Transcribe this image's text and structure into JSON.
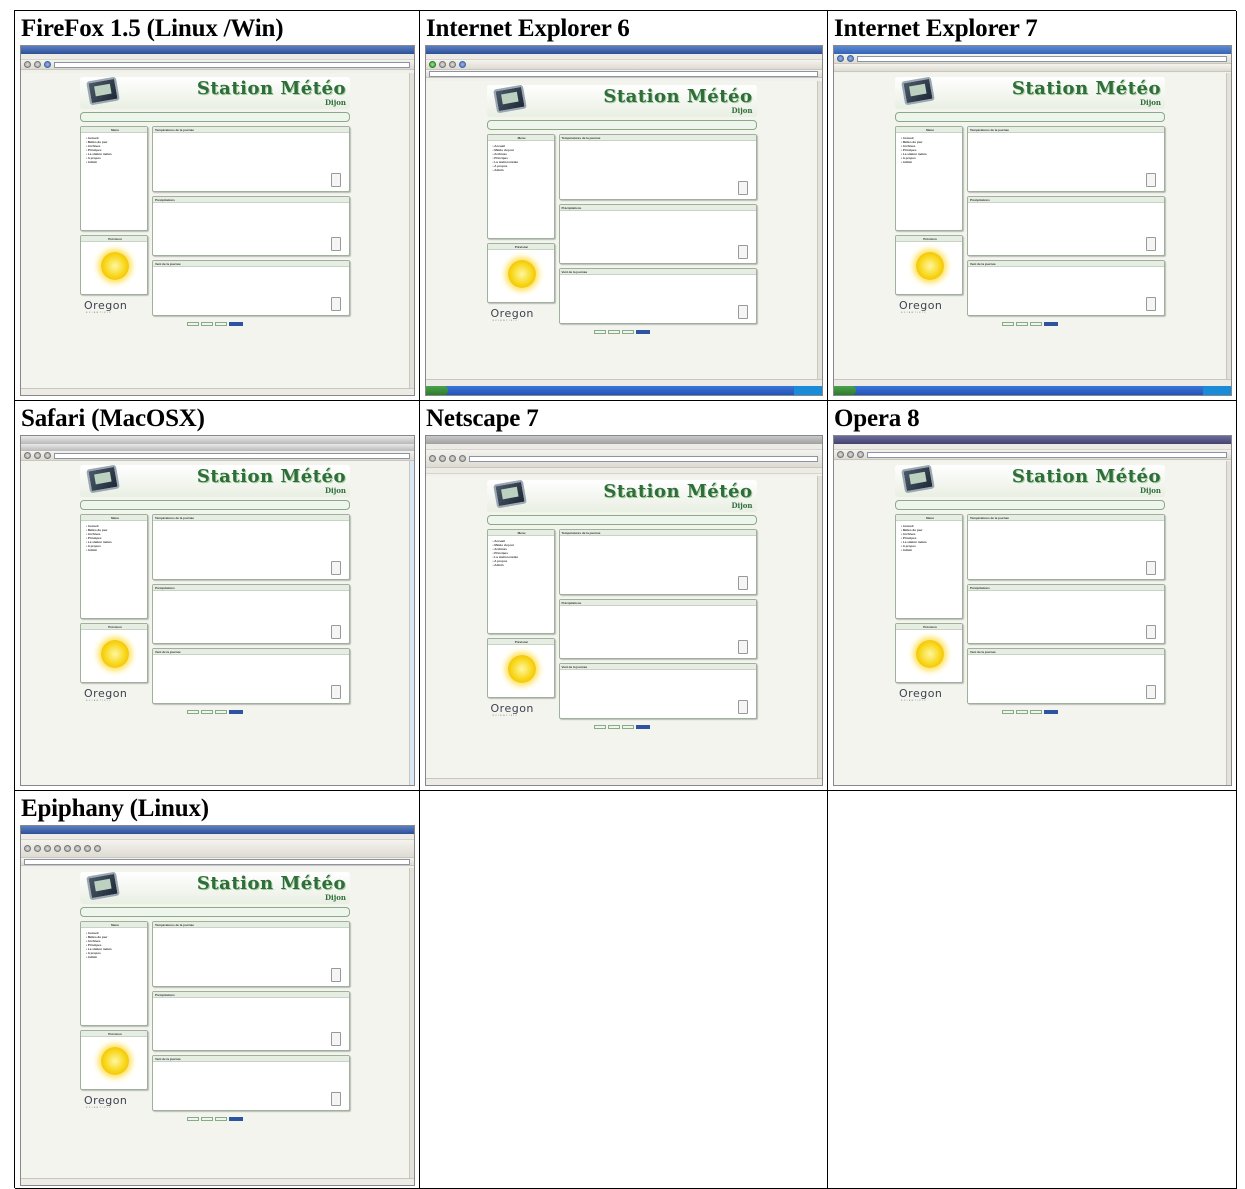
{
  "cells": [
    {
      "title": "FireFox 1.5 (Linux /Win)"
    },
    {
      "title": "Internet Explorer 6"
    },
    {
      "title": "Internet Explorer 7"
    },
    {
      "title": "Safari (MacOSX)"
    },
    {
      "title": "Netscape 7"
    },
    {
      "title": "Opera 8"
    },
    {
      "title": "Epiphany (Linux)"
    },
    {
      "title": ""
    },
    {
      "title": ""
    }
  ],
  "mini_page": {
    "brand_title": "Station Météo",
    "brand_city": "Dijon",
    "menu_heading": "Menu",
    "menu_items": [
      "Accueil",
      "Météo du jour",
      "Archives",
      "Principes",
      "La station météo",
      "A propos",
      "Admin"
    ],
    "prevision_heading": "Prévision",
    "temp_heading": "Températures de la journée",
    "rain_heading": "Précipitations",
    "wind_heading": "Vent de la journée",
    "logo": "Oregon",
    "logo_sub": "SCIENTIFIC"
  },
  "colors": {
    "brand_green": "#2f6e3b",
    "box_border": "#9fb09b",
    "sun": "#f7d514"
  }
}
